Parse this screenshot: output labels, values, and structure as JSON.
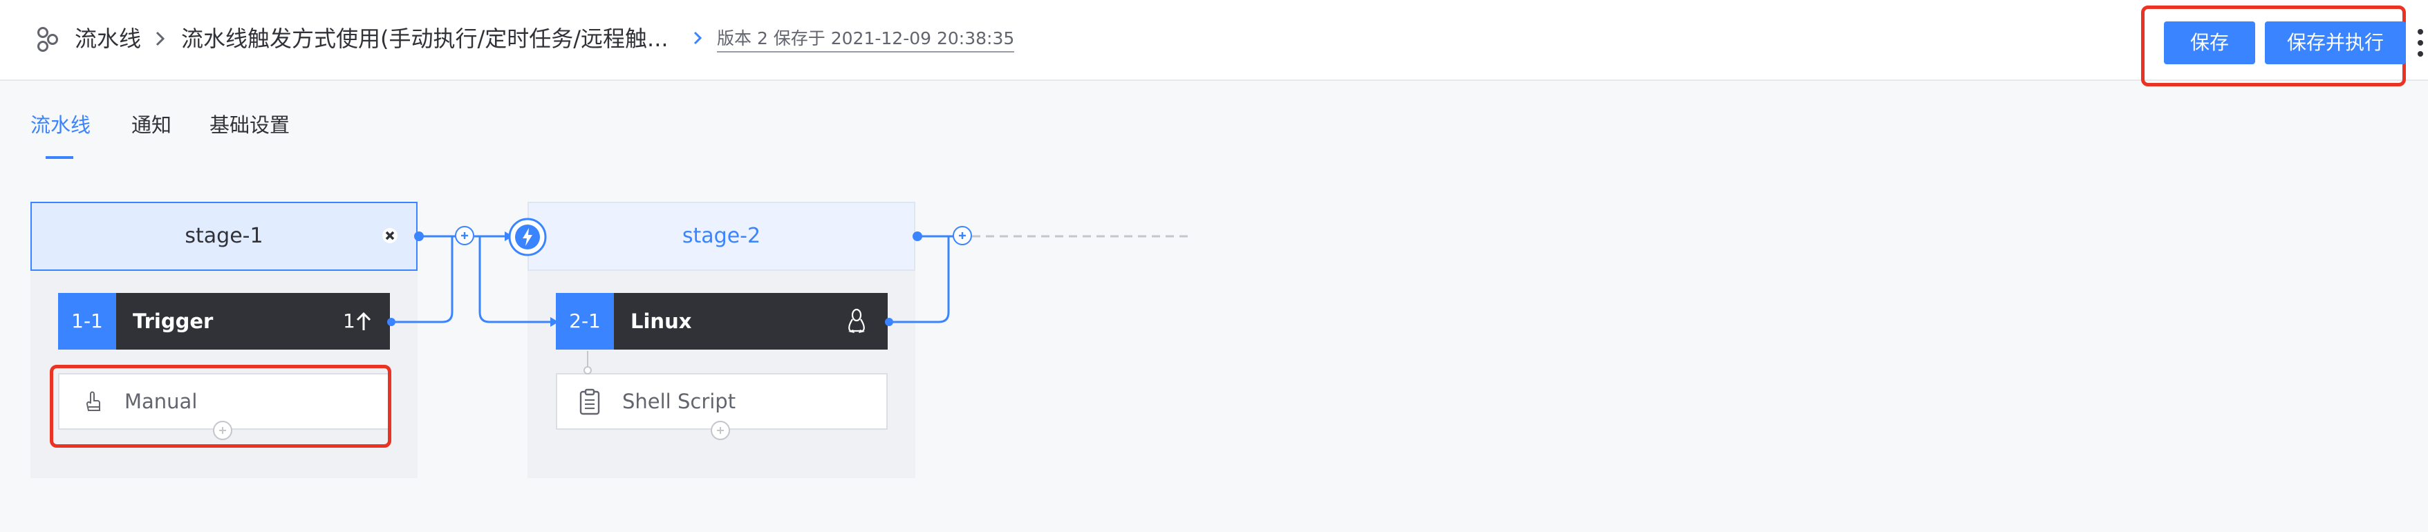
{
  "header": {
    "breadcrumb_root": "流水线",
    "pipeline_name": "流水线触发方式使用(手动执行/定时任务/远程触...",
    "version_info": "版本 2 保存于 2021-12-09 20:38:35",
    "save_label": "保存",
    "save_run_label": "保存并执行"
  },
  "tabs": [
    {
      "label": "流水线",
      "active": true
    },
    {
      "label": "通知",
      "active": false
    },
    {
      "label": "基础设置",
      "active": false
    }
  ],
  "stages": [
    {
      "name": "stage-1",
      "job": {
        "id": "1-1",
        "name": "Trigger",
        "count": "1",
        "os_icon": "arrow-up-icon"
      },
      "atom": {
        "name": "Manual",
        "icon": "hand-pointer-icon"
      }
    },
    {
      "name": "stage-2",
      "job": {
        "id": "2-1",
        "name": "Linux",
        "os_icon": "linux-icon"
      },
      "atom": {
        "name": "Shell Script",
        "icon": "clipboard-icon"
      }
    }
  ],
  "colors": {
    "accent": "#3a84ff",
    "highlight": "#ea3323",
    "job_dark": "#313238"
  }
}
